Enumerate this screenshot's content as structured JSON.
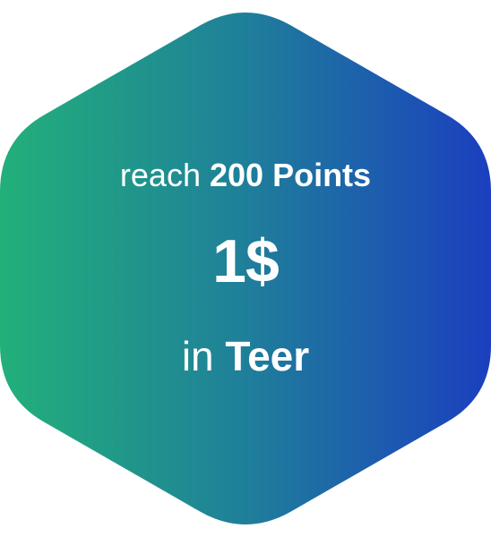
{
  "badge": {
    "line1_prefix": "reach",
    "line1_emphasis": "200 Points",
    "amount": "1$",
    "line3_prefix": "in",
    "line3_emphasis": "Teer"
  },
  "colors": {
    "gradient_start": "#22b07a",
    "gradient_mid": "#1f7f9a",
    "gradient_end": "#1b3fbf",
    "text": "#ffffff"
  }
}
